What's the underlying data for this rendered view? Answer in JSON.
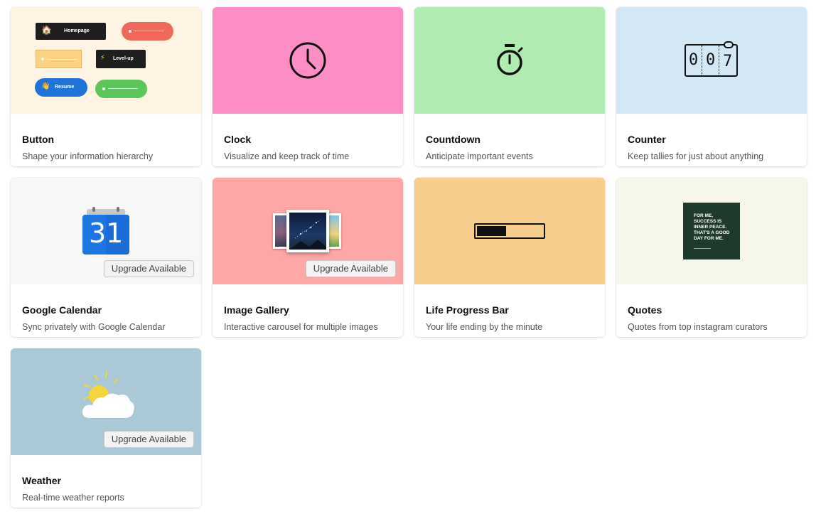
{
  "widgets": [
    {
      "title": "Button",
      "description": "Shape your information hierarchy",
      "bg": "#fff3e3"
    },
    {
      "title": "Clock",
      "description": "Visualize and keep track of time",
      "bg": "#fb8ec4"
    },
    {
      "title": "Countdown",
      "description": "Anticipate important events",
      "bg": "#b0ebb2"
    },
    {
      "title": "Counter",
      "description": "Keep tallies for just about anything",
      "bg": "#d3e8f4"
    },
    {
      "title": "Google Calendar",
      "description": "Sync privately with Google Calendar",
      "bg": "#f7f7f7",
      "upgrade": "Upgrade Available"
    },
    {
      "title": "Image Gallery",
      "description": "Interactive carousel for multiple images",
      "bg": "#fea7a7",
      "upgrade": "Upgrade Available"
    },
    {
      "title": "Life Progress Bar",
      "description": "Your life ending by the minute",
      "bg": "#f7cd8b",
      "progress": 0.45
    },
    {
      "title": "Quotes",
      "description": "Quotes from top instagram curators",
      "bg": "#f7f6ea"
    },
    {
      "title": "Weather",
      "description": "Real-time weather reports",
      "bg": "#abc8d6",
      "upgrade": "Upgrade Available"
    }
  ],
  "button_thumb": {
    "homepage": "Homepage",
    "levelup": "Level-up",
    "resume": "Resume"
  },
  "counter_thumb": {
    "digits": [
      "0",
      "0",
      "7"
    ]
  },
  "calendar_thumb": {
    "day": "31"
  },
  "quote_thumb": {
    "text": "FOR ME, SUCCESS IS INNER PEACE. THAT'S A GOOD DAY FOR ME."
  }
}
